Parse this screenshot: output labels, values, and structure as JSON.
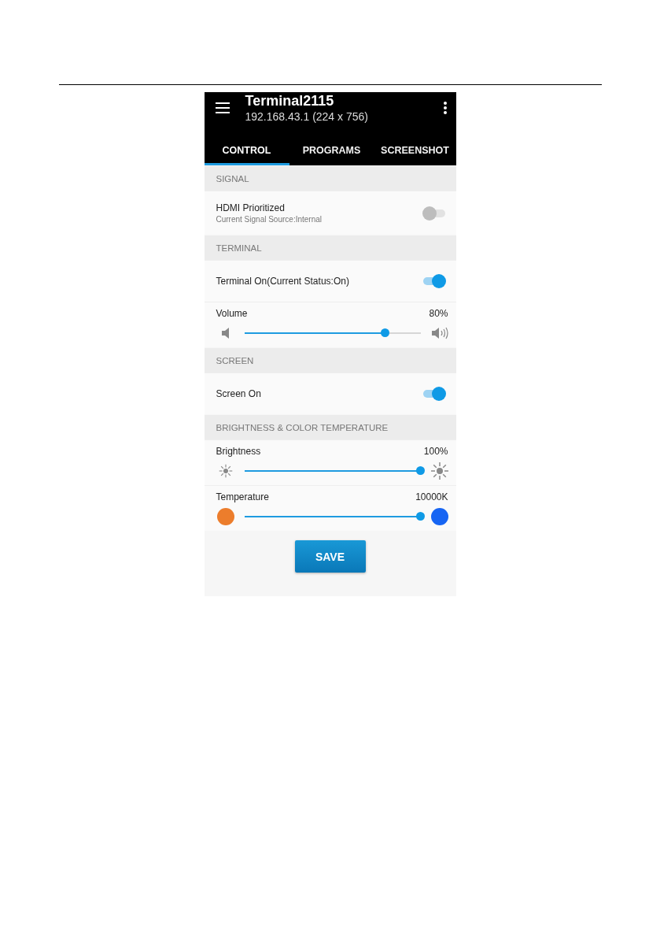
{
  "app_bar": {
    "title": "Terminal2115",
    "subtitle": "192.168.43.1 (224 x 756)"
  },
  "tabs": [
    {
      "label": "CONTROL",
      "selected": true
    },
    {
      "label": "PROGRAMS",
      "selected": false
    },
    {
      "label": "SCREENSHOT",
      "selected": false
    }
  ],
  "sections": [
    {
      "title": "SIGNAL",
      "rows": [
        {
          "kind": "toggle",
          "label": "HDMI Prioritized",
          "sublabel": "Current Signal Source:Internal",
          "on": false
        }
      ]
    },
    {
      "title": "TERMINAL",
      "rows": [
        {
          "kind": "toggle",
          "label": "Terminal On(Current Status:On)",
          "on": true
        },
        {
          "kind": "volume-slider",
          "label": "Volume",
          "reading": "80%",
          "level": 0.8
        }
      ]
    },
    {
      "title": "SCREEN",
      "rows": [
        {
          "kind": "toggle",
          "label": "Screen On",
          "on": true
        }
      ]
    },
    {
      "title": "BRIGHTNESS & COLOR TEMPERATURE",
      "rows": [
        {
          "kind": "brightness-slider",
          "label": "Brightness",
          "reading": "100%",
          "level": 1
        },
        {
          "kind": "temperature-slider",
          "label": "Temperature",
          "reading": "10000K",
          "level": 1
        }
      ]
    }
  ],
  "save_button": "SAVE"
}
